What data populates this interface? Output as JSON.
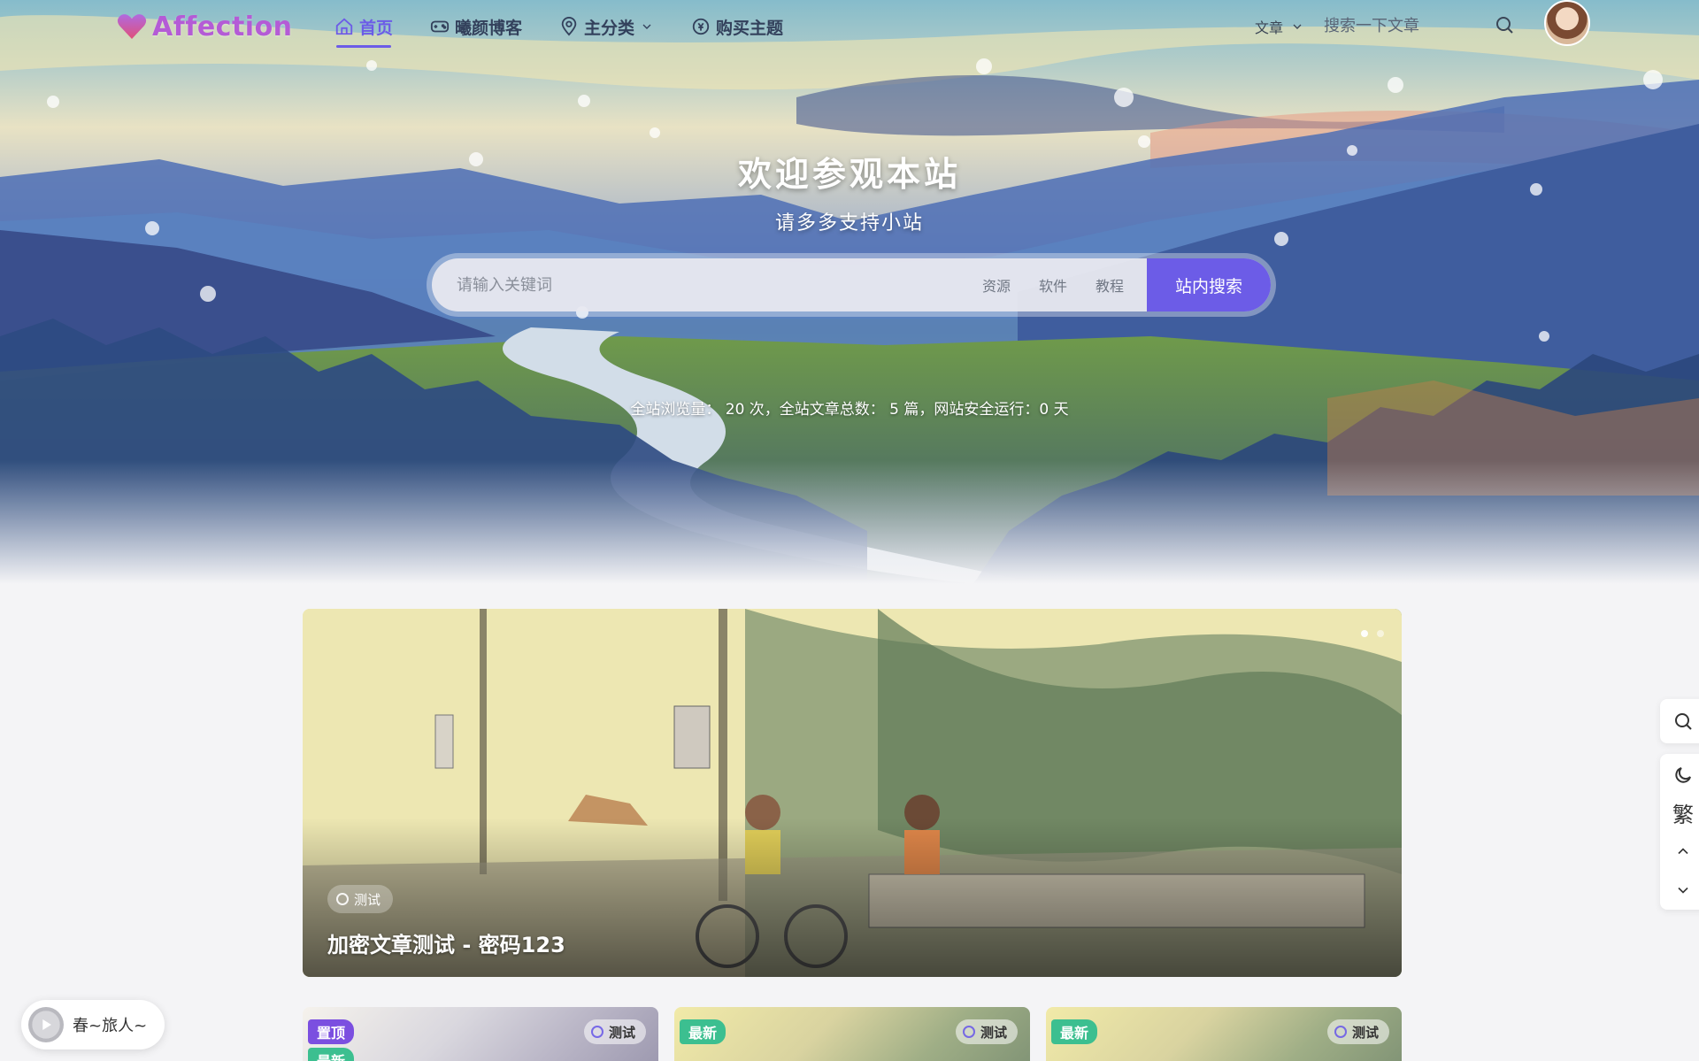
{
  "brand": {
    "name": "Affection"
  },
  "nav": {
    "items": [
      {
        "label": "首页",
        "icon": "home-icon",
        "active": true
      },
      {
        "label": "曦颜博客",
        "icon": "gamepad-icon",
        "active": false
      },
      {
        "label": "主分类",
        "icon": "map-pin-icon",
        "active": false,
        "has_dropdown": true
      },
      {
        "label": "购买主题",
        "icon": "coin-icon",
        "active": false
      }
    ],
    "search_type": "文章",
    "search_placeholder": "搜索一下文章"
  },
  "hero": {
    "title": "欢迎参观本站",
    "subtitle": "请多多支持小站",
    "search_placeholder": "请输入关键词",
    "tags": [
      "资源",
      "软件",
      "教程"
    ],
    "search_button": "站内搜索",
    "stats": "全站浏览量： 20 次，全站文章总数： 5 篇，网站安全运行：0 天"
  },
  "featured": {
    "tag": "测试",
    "title": "加密文章测试 - 密码123"
  },
  "cards": [
    {
      "badges": [
        "置顶",
        "最新"
      ],
      "tag": "测试"
    },
    {
      "badges": [
        "最新"
      ],
      "tag": "测试"
    },
    {
      "badges": [
        "最新"
      ],
      "tag": "测试"
    }
  ],
  "float_tools": {
    "traditional_label": "繁"
  },
  "music": {
    "title": "春~旅人~"
  },
  "colors": {
    "accent": "#6c5ce7",
    "pin_badge": "#7b4fe0",
    "new_badge": "#3cbf90"
  }
}
